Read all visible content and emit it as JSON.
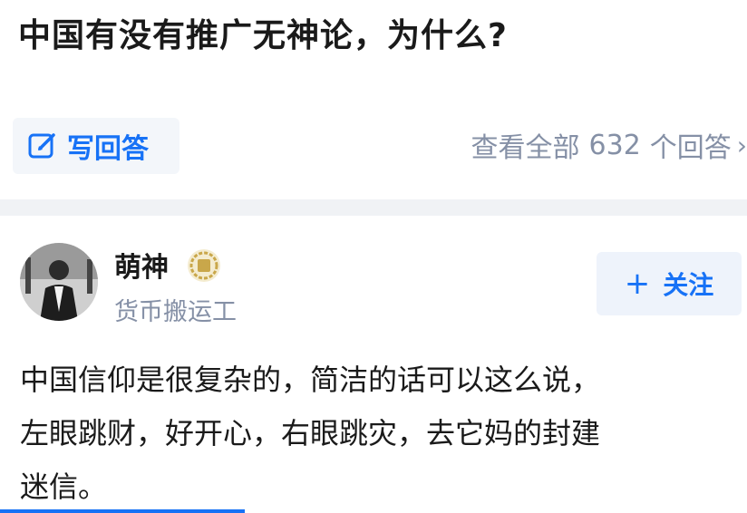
{
  "question": {
    "title": "中国有没有推广无神论，为什么?"
  },
  "actions": {
    "write_answer_label": "写回答",
    "view_all_prefix": "查看全部",
    "view_all_count": "632",
    "view_all_suffix": "个回答",
    "chevron": "›"
  },
  "author": {
    "name": "萌神",
    "headline": "货币搬运工",
    "follow_label": "关注",
    "follow_icon": "+"
  },
  "answer": {
    "lines": [
      "中国信仰是很复杂的，简洁的话可以这么说，",
      "左眼跳财，好开心，右眼跳灾，去它妈的封建",
      "迷信。"
    ]
  },
  "colors": {
    "accent": "#1772f6",
    "muted": "#8590a6",
    "button_bg": "#f3f6fa"
  }
}
